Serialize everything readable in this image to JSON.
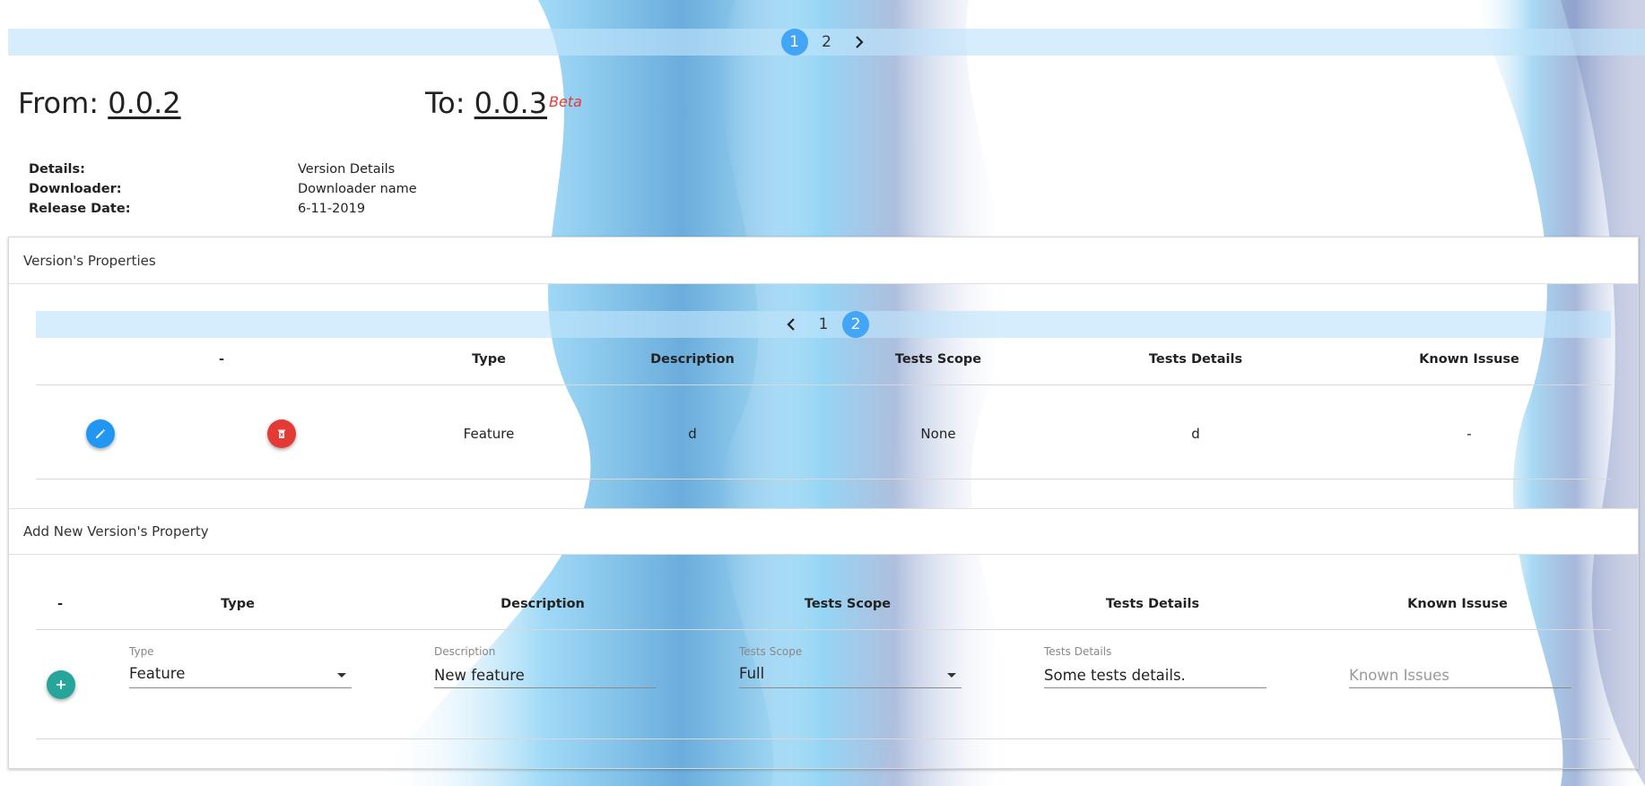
{
  "colors": {
    "accent_blue": "#42a5f5",
    "delete_red": "#e53935",
    "add_green": "#26a69a",
    "beta_red": "#e53935",
    "pager_bg": "#bee4fa"
  },
  "top_pager": {
    "pages": [
      "1",
      "2"
    ],
    "active": "1",
    "next_icon": "chevron-right-icon"
  },
  "header": {
    "from_label": "From:",
    "from_version": "0.0.2",
    "to_label": "To:",
    "to_version": "0.0.3",
    "beta": "Beta"
  },
  "details": [
    {
      "key": "Details:",
      "value": "Version Details"
    },
    {
      "key": "Downloader:",
      "value": "Downloader name"
    },
    {
      "key": "Release Date:",
      "value": "6-11-2019"
    }
  ],
  "properties": {
    "title": "Version's Properties",
    "pager": {
      "prev_icon": "chevron-left-icon",
      "pages": [
        "1",
        "2"
      ],
      "active": "2"
    },
    "columns": [
      "-",
      "Type",
      "Description",
      "Tests Scope",
      "Tests Details",
      "Known Issuse"
    ],
    "rows": [
      {
        "edit_icon": "pencil-icon",
        "delete_icon": "trash-icon",
        "type": "Feature",
        "description": "d",
        "tests_scope": "None",
        "tests_details": "d",
        "known_issue": "-"
      }
    ]
  },
  "add_new": {
    "title": "Add New Version's Property",
    "columns": [
      "-",
      "Type",
      "Description",
      "Tests Scope",
      "Tests Details",
      "Known Issuse"
    ],
    "add_icon": "plus-icon",
    "fields": {
      "type": {
        "label": "Type",
        "value": "Feature"
      },
      "description": {
        "label": "Description",
        "value": "New feature"
      },
      "tests_scope": {
        "label": "Tests Scope",
        "value": "Full"
      },
      "tests_details": {
        "label": "Tests Details",
        "value": "Some tests details."
      },
      "known_issues": {
        "placeholder": "Known Issues"
      }
    }
  }
}
